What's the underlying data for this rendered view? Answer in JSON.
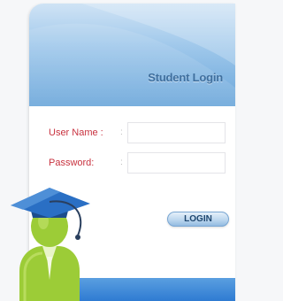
{
  "login": {
    "title": "Student Login",
    "username_label": "User Name :",
    "username_colon": ":",
    "username_value": "",
    "password_label": "Password:",
    "password_colon": ":",
    "password_value": "",
    "button_label": "LOGIN"
  },
  "colors": {
    "header_blue": "#6aa6da",
    "title_blue": "#3f6f9e",
    "label_red": "#c8323f",
    "footer_blue": "#2f7bd2",
    "figure_green": "#9ccc37"
  },
  "icons": {
    "student": "student-graduate-icon"
  }
}
